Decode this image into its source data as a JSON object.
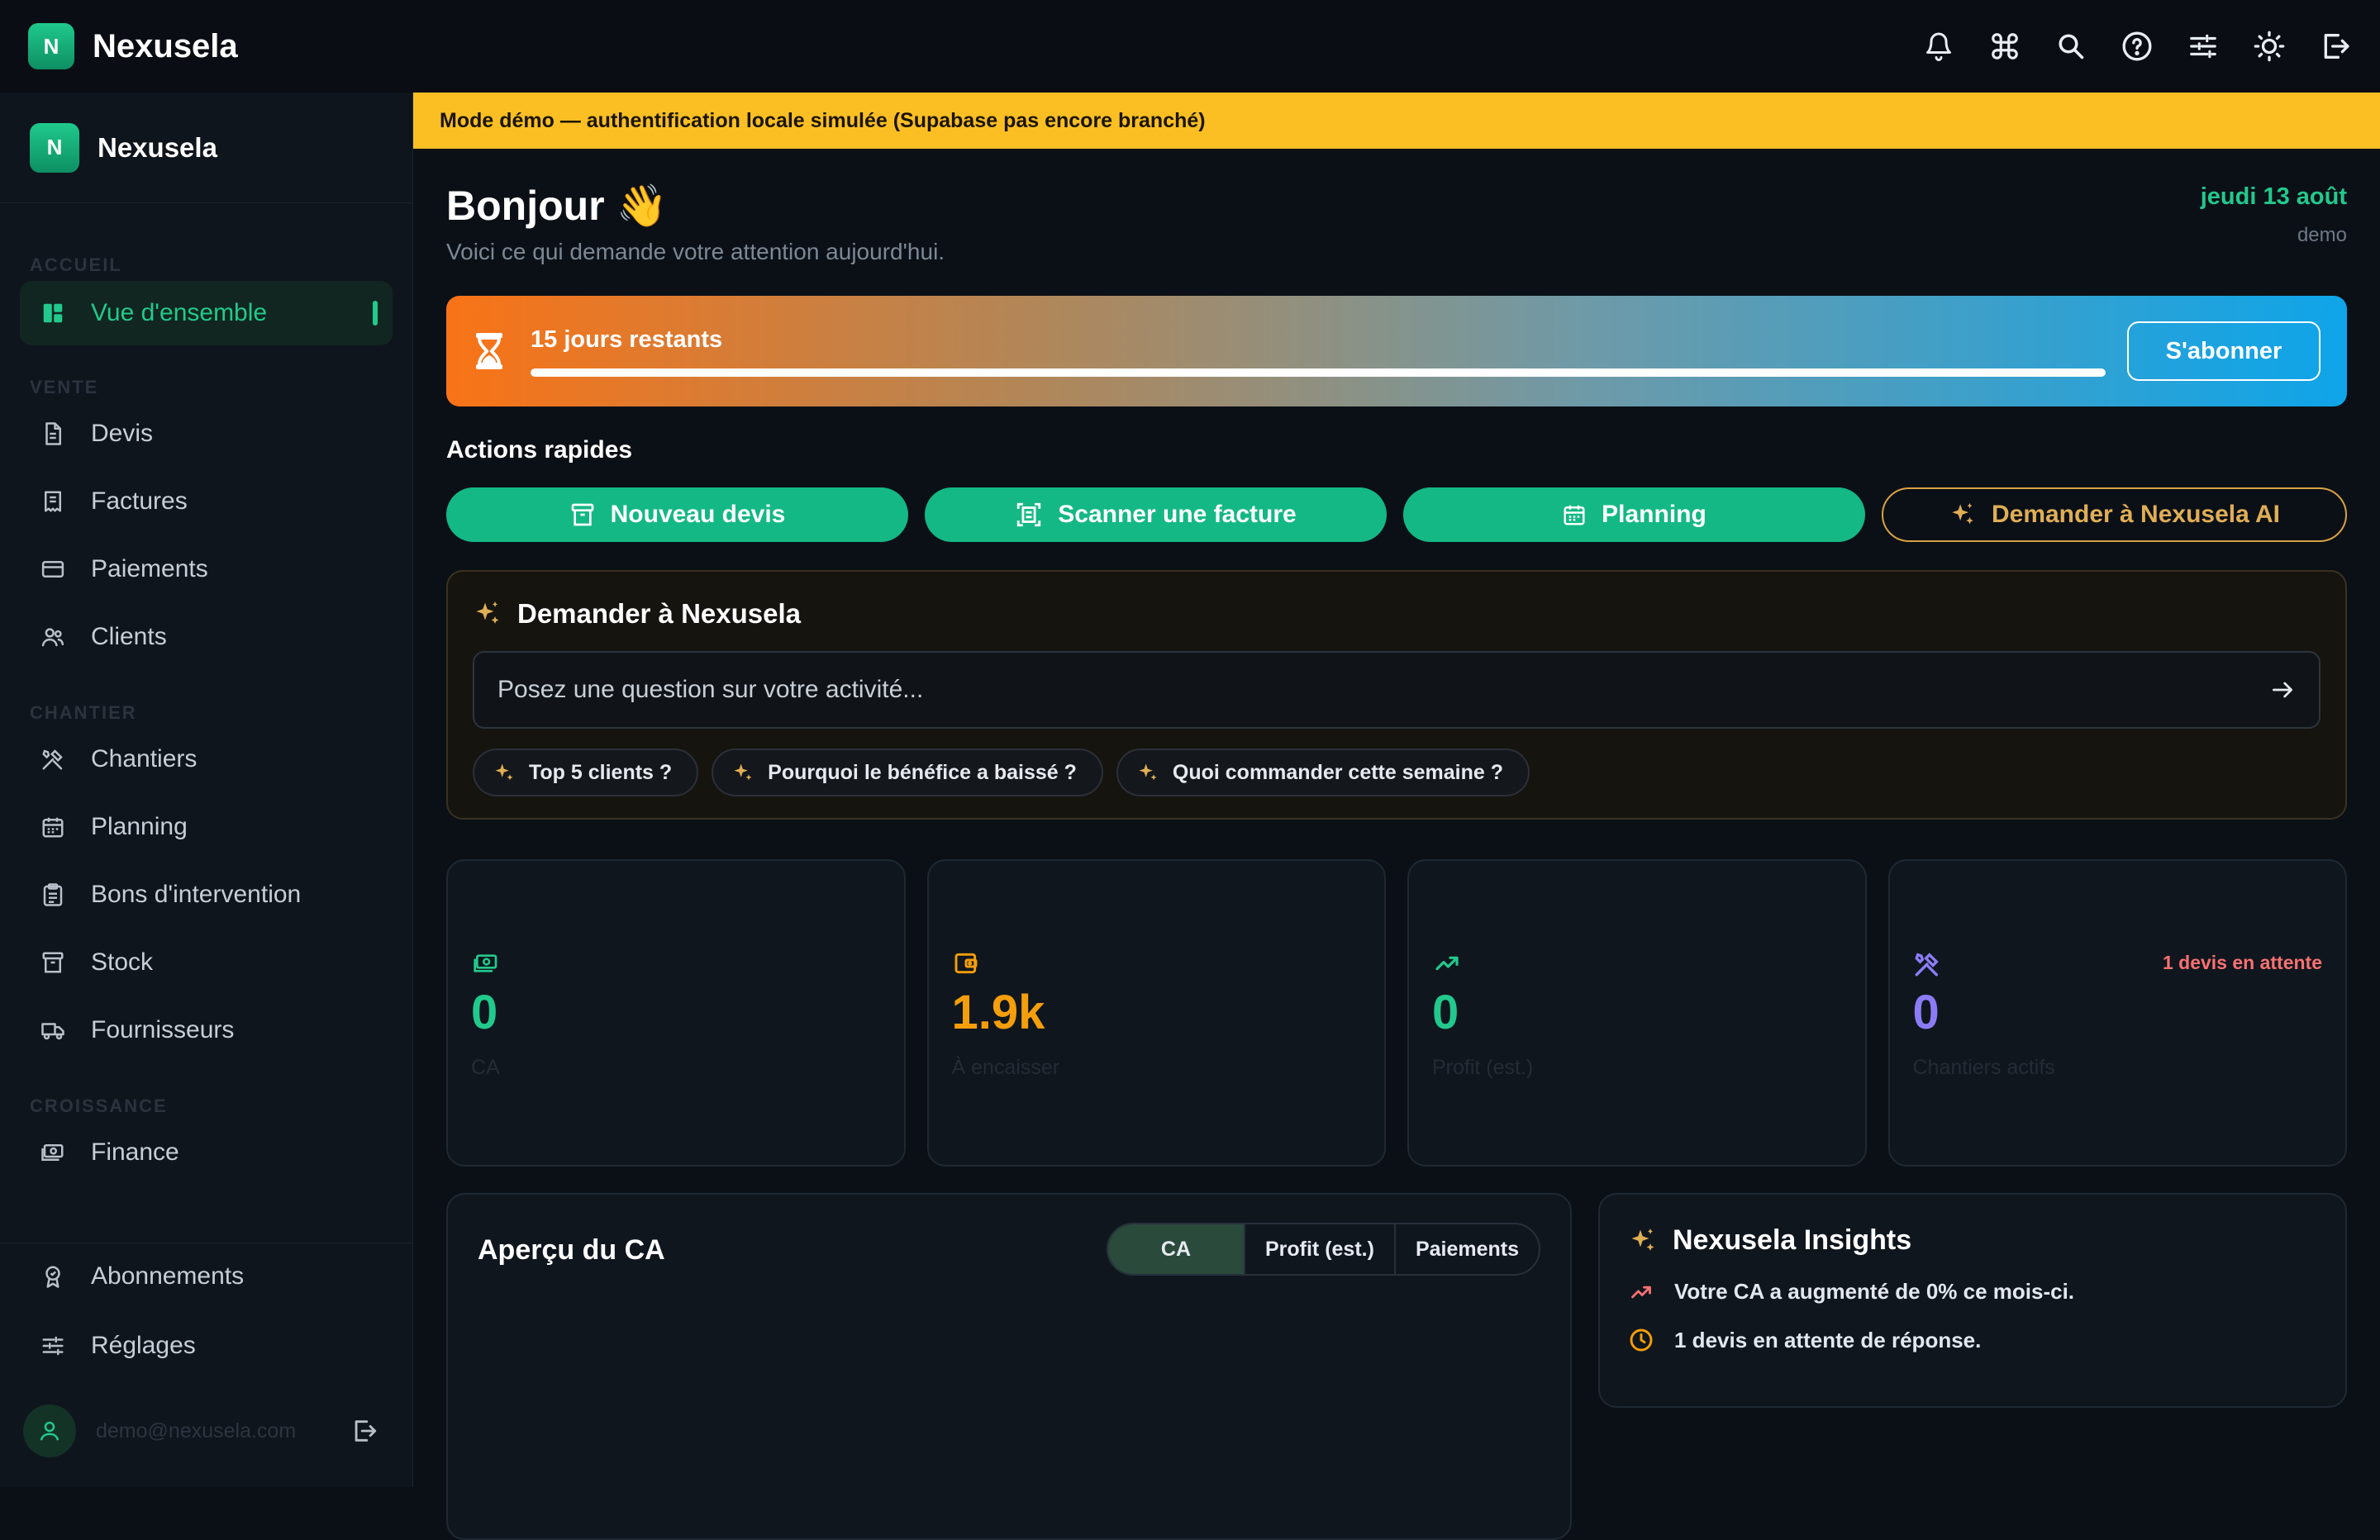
{
  "app": {
    "name": "Nexusela",
    "logo_letter": "N"
  },
  "topbar": {
    "icons": [
      "bell-icon",
      "command-icon",
      "search-icon",
      "help-icon",
      "sliders-icon",
      "sun-icon",
      "logout-icon"
    ]
  },
  "sidebar": {
    "brand": "Nexusela",
    "sections": {
      "accueil": "ACCUEIL",
      "vente": "VENTE",
      "chantier": "CHANTIER",
      "croissance": "CROISSANCE"
    },
    "items": {
      "overview": "Vue d'ensemble",
      "devis": "Devis",
      "factures": "Factures",
      "paiements": "Paiements",
      "clients": "Clients",
      "chantiers": "Chantiers",
      "planning": "Planning",
      "bons": "Bons d'intervention",
      "stock": "Stock",
      "fournisseurs": "Fournisseurs",
      "finance": "Finance",
      "abonnements": "Abonnements",
      "reglages": "Réglages"
    },
    "user_email": "demo@nexusela.com",
    "active_color": "#22c98c"
  },
  "banner": {
    "text": "Mode démo — authentification locale simulée (Supabase pas encore branché)",
    "color": "#fbbf24"
  },
  "greeting": {
    "title": "Bonjour 👋",
    "subtitle": "Voici ce qui demande votre attention aujourd'hui.",
    "date": "jeudi 13 août",
    "user": "demo"
  },
  "trial": {
    "label": "15 jours restants",
    "progress": 1.0,
    "subscribe_label": "S'abonner"
  },
  "quick_actions": {
    "title": "Actions rapides",
    "new_quote": "Nouveau devis",
    "scan_invoice": "Scanner une facture",
    "planning": "Planning",
    "ask_ai": "Demander à Nexusela AI"
  },
  "ask": {
    "title": "Demander à Nexusela",
    "placeholder": "Posez une question sur votre activité...",
    "suggestions": [
      "Top 5 clients ?",
      "Pourquoi le bénéfice a baissé ?",
      "Quoi commander cette semaine ?"
    ]
  },
  "stats": [
    {
      "value": "0",
      "label": "CA",
      "color": "#22c98c",
      "icon": "cash-icon"
    },
    {
      "value": "1.9k",
      "label": "À encaisser",
      "color": "#f59e0b",
      "icon": "wallet-icon"
    },
    {
      "value": "0",
      "label": "Profit (est.)",
      "color": "#22c98c",
      "icon": "trending-up-icon"
    },
    {
      "value": "0",
      "label": "Chantiers actifs",
      "color": "#8b7cf6",
      "icon": "tools-icon",
      "note": "1 devis en attente"
    }
  ],
  "ca_panel": {
    "title": "Aperçu du CA",
    "tabs": [
      "CA",
      "Profit (est.)",
      "Paiements"
    ],
    "selected": "CA"
  },
  "insights": {
    "title": "Nexusela Insights",
    "items": [
      "Votre CA a augmenté de 0% ce mois-ci.",
      "1 devis en attente de réponse."
    ]
  }
}
